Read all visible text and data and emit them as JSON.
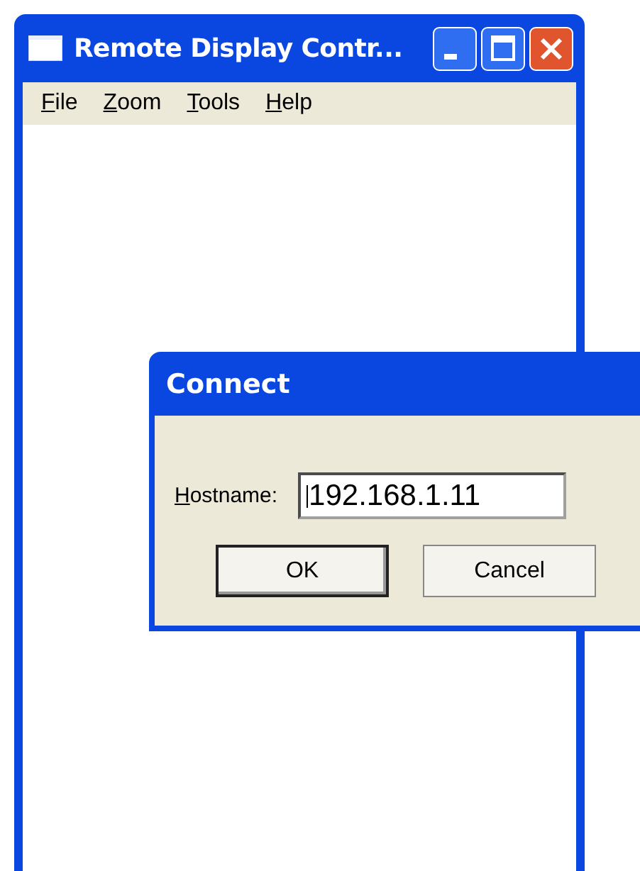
{
  "window": {
    "title": "Remote Display Contr..."
  },
  "menu": [
    "File",
    "Zoom",
    "Tools",
    "Help"
  ],
  "dialog": {
    "title": "Connect",
    "field": {
      "label": "Hostname:",
      "value": "192.168.1.11"
    },
    "buttons": [
      {
        "label": "OK",
        "default": true
      },
      {
        "label": "Cancel",
        "default": false
      }
    ]
  }
}
